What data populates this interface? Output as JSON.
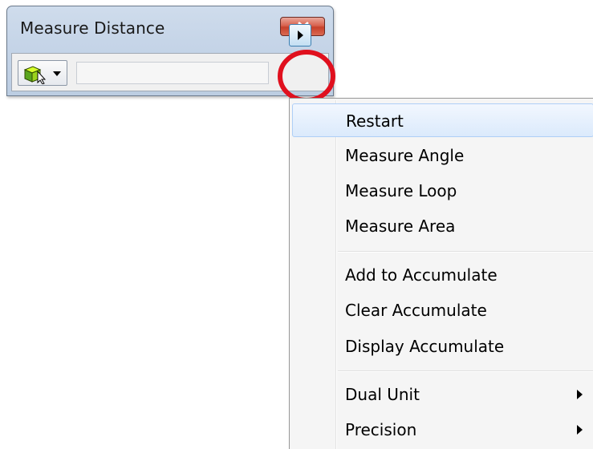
{
  "window": {
    "title": "Measure Distance",
    "close_icon": "close-icon",
    "tool_icon": "measure-cube-cursor-icon",
    "value_field": ""
  },
  "menu": {
    "items": [
      {
        "label": "Restart",
        "highlighted": true
      },
      {
        "label": "Measure Angle"
      },
      {
        "label": "Measure Loop"
      },
      {
        "label": "Measure Area"
      },
      {
        "label": "Add to Accumulate"
      },
      {
        "label": "Clear Accumulate"
      },
      {
        "label": "Display Accumulate"
      },
      {
        "label": "Dual Unit",
        "submenu": true
      },
      {
        "label": "Precision",
        "submenu": true
      }
    ]
  },
  "colors": {
    "highlight_ring": "#e0101e",
    "menu_hover": "#dbeafc",
    "title_bar": "#c6d5e8"
  }
}
